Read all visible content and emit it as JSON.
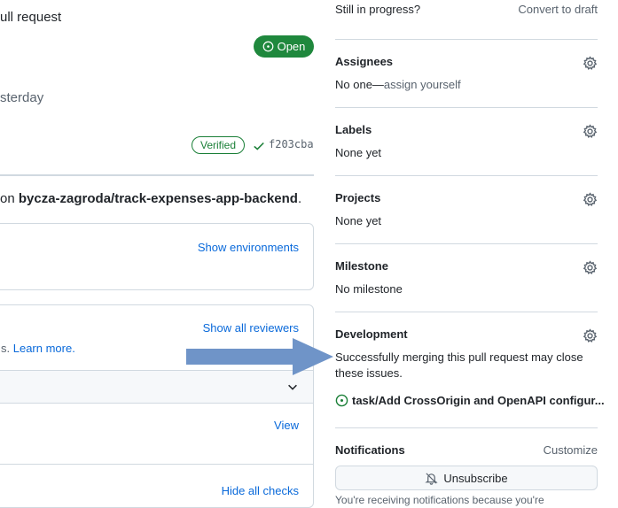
{
  "pr": {
    "title_fragment": "ull request",
    "state_label": "Open",
    "time_fragment": "sterday"
  },
  "commit": {
    "verified_label": "Verified",
    "sha": "f203cba"
  },
  "merge_target": {
    "prefix": "on ",
    "repo": "bycza-zagroda/track-expenses-app-backend",
    "suffix": "."
  },
  "deployments": {
    "show_environments": "Show environments"
  },
  "reviewers": {
    "show_all": "Show all reviewers",
    "text_fragment": "s. ",
    "learn_more": "Learn more."
  },
  "checks": {
    "view_label": "View",
    "hide_all": "Hide all checks"
  },
  "sidebar": {
    "draft": {
      "text": "Still in progress?",
      "link": "Convert to draft"
    },
    "assignees": {
      "title": "Assignees",
      "value_prefix": "No one—",
      "value_link": "assign yourself"
    },
    "labels": {
      "title": "Labels",
      "value": "None yet"
    },
    "projects": {
      "title": "Projects",
      "value": "None yet"
    },
    "milestone": {
      "title": "Milestone",
      "value": "No milestone"
    },
    "development": {
      "title": "Development",
      "desc_line1": "Successfully merging this pull request may close",
      "desc_line2": "these issues.",
      "issue": "task/Add CrossOrigin and OpenAPI configur..."
    },
    "notifications": {
      "title": "Notifications",
      "customize": "Customize",
      "button": "Unsubscribe",
      "footer_fragment": "You're receiving notifications because you're"
    }
  },
  "colors": {
    "accent": "#0969da",
    "open": "#1f883d",
    "arrow": "#6f94c8"
  }
}
